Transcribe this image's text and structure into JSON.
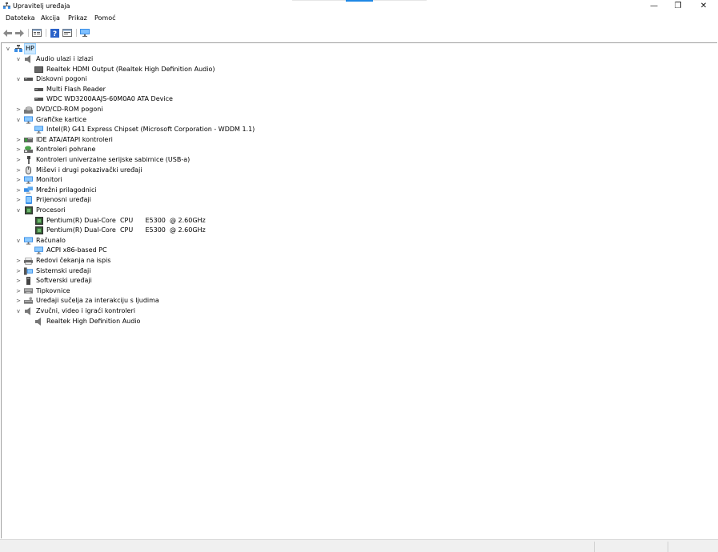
{
  "window": {
    "title": "Upravitelj uređaja",
    "minimize_glyph": "—",
    "maximize_glyph": "❐",
    "close_glyph": "✕"
  },
  "menu": [
    "Datoteka",
    "Akcija",
    "Prikaz",
    "Pomoć"
  ],
  "toolbar": {
    "buttons": [
      "back-arrow-icon",
      "forward-arrow-icon",
      "properties-icon",
      "help-icon",
      "show-hide-icon",
      "monitor-icon"
    ]
  },
  "tree": {
    "root": {
      "label": "HP",
      "icon": "computer-icon"
    },
    "nodes": [
      {
        "level": 1,
        "exp": "v",
        "icon": "speaker-icon",
        "label": "Audio ulazi i izlazi"
      },
      {
        "level": 2,
        "exp": "",
        "icon": "display-output-icon",
        "label": "Realtek HDMI Output (Realtek High Definition Audio)"
      },
      {
        "level": 1,
        "exp": "v",
        "icon": "disk-icon",
        "label": "Diskovni pogoni"
      },
      {
        "level": 2,
        "exp": "",
        "icon": "disk-icon",
        "label": "Multi Flash Reader"
      },
      {
        "level": 2,
        "exp": "",
        "icon": "disk-icon",
        "label": "WDC WD3200AAJS-60M0A0 ATA Device"
      },
      {
        "level": 1,
        "exp": ">",
        "icon": "dvd-icon",
        "label": "DVD/CD-ROM pogoni"
      },
      {
        "level": 1,
        "exp": "v",
        "icon": "display-adapter-icon",
        "label": "Grafičke kartice"
      },
      {
        "level": 2,
        "exp": "",
        "icon": "display-adapter-icon",
        "label": "Intel(R) G41 Express Chipset (Microsoft Corporation - WDDM 1.1)"
      },
      {
        "level": 1,
        "exp": ">",
        "icon": "ide-controller-icon",
        "label": "IDE ATA/ATAPI kontroleri"
      },
      {
        "level": 1,
        "exp": ">",
        "icon": "storage-controller-icon",
        "label": "Kontroleri pohrane"
      },
      {
        "level": 1,
        "exp": ">",
        "icon": "usb-icon",
        "label": "Kontroleri univerzalne serijske sabirnice (USB-a)"
      },
      {
        "level": 1,
        "exp": ">",
        "icon": "mouse-icon",
        "label": "Miševi i drugi pokazivački uređaji"
      },
      {
        "level": 1,
        "exp": ">",
        "icon": "monitor-icon",
        "label": "Monitori"
      },
      {
        "level": 1,
        "exp": ">",
        "icon": "network-adapter-icon",
        "label": "Mrežni prilagodnici"
      },
      {
        "level": 1,
        "exp": ">",
        "icon": "portable-device-icon",
        "label": "Prijenosni uređaji"
      },
      {
        "level": 1,
        "exp": "v",
        "icon": "processor-icon",
        "label": "Procesori"
      },
      {
        "level": 2,
        "exp": "",
        "icon": "processor-icon",
        "label": "Pentium(R) Dual-Core  CPU      E5300  @ 2.60GHz"
      },
      {
        "level": 2,
        "exp": "",
        "icon": "processor-icon",
        "label": "Pentium(R) Dual-Core  CPU      E5300  @ 2.60GHz"
      },
      {
        "level": 1,
        "exp": "v",
        "icon": "monitor-icon",
        "label": "Računalo"
      },
      {
        "level": 2,
        "exp": "",
        "icon": "monitor-icon",
        "label": "ACPI x86-based PC"
      },
      {
        "level": 1,
        "exp": ">",
        "icon": "print-queue-icon",
        "label": "Redovi čekanja na ispis"
      },
      {
        "level": 1,
        "exp": ">",
        "icon": "system-device-icon",
        "label": "Sistemski uređaji"
      },
      {
        "level": 1,
        "exp": ">",
        "icon": "software-device-icon",
        "label": "Softverski uređaji"
      },
      {
        "level": 1,
        "exp": ">",
        "icon": "keyboard-icon",
        "label": "Tipkovnice"
      },
      {
        "level": 1,
        "exp": ">",
        "icon": "hid-icon",
        "label": "Uređaji sučelja za interakciju s ljudima"
      },
      {
        "level": 1,
        "exp": "v",
        "icon": "speaker-icon",
        "label": "Zvučni, video i igraći kontroleri"
      },
      {
        "level": 2,
        "exp": "",
        "icon": "speaker-icon",
        "label": "Realtek High Definition Audio"
      }
    ]
  },
  "colors": {
    "accent": "#1e88e5",
    "selection": "#cce8ff",
    "monitor_blue": "#3a8ee6",
    "processor_green": "#3c7a3c"
  }
}
